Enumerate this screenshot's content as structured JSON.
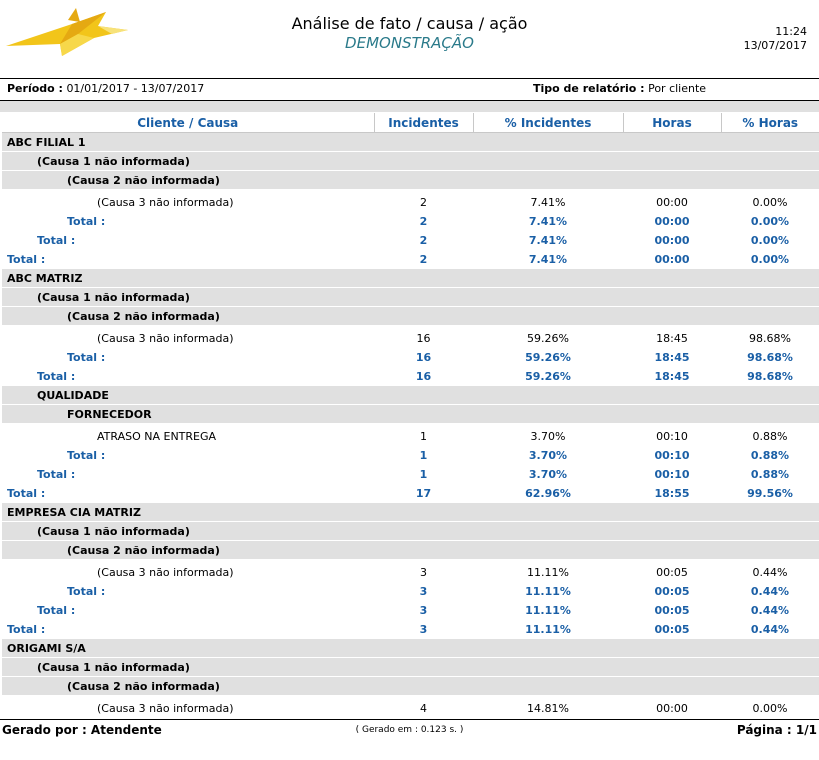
{
  "header": {
    "title": "Análise de fato / causa / ação",
    "subtitle": "DEMONSTRAÇÃO",
    "time": "11:24",
    "date": "13/07/2017"
  },
  "params": {
    "period_label": "Período :",
    "period_value": "01/01/2017 - 13/07/2017",
    "type_label": "Tipo de relatório :",
    "type_value": "Por cliente"
  },
  "columns": [
    "Cliente / Causa",
    "Incidentes",
    "% Incidentes",
    "Horas",
    "% Horas"
  ],
  "rows": [
    {
      "type": "grp",
      "level": 0,
      "label": "ABC FILIAL 1"
    },
    {
      "type": "grp",
      "level": 1,
      "label": "(Causa 1 não informada)"
    },
    {
      "type": "grp",
      "level": 2,
      "label": "(Causa 2 não informada)"
    },
    {
      "type": "det",
      "label": "(Causa 3 não informada)",
      "inc": "2",
      "pinc": "7.41%",
      "hrs": "00:00",
      "phrs": "0.00%"
    },
    {
      "type": "tot",
      "level": 2,
      "label": "Total :",
      "inc": "2",
      "pinc": "7.41%",
      "hrs": "00:00",
      "phrs": "0.00%"
    },
    {
      "type": "tot",
      "level": 1,
      "label": "Total :",
      "inc": "2",
      "pinc": "7.41%",
      "hrs": "00:00",
      "phrs": "0.00%"
    },
    {
      "type": "tot",
      "level": 0,
      "label": "Total :",
      "inc": "2",
      "pinc": "7.41%",
      "hrs": "00:00",
      "phrs": "0.00%"
    },
    {
      "type": "grp",
      "level": 0,
      "label": "ABC MATRIZ"
    },
    {
      "type": "grp",
      "level": 1,
      "label": "(Causa 1 não informada)"
    },
    {
      "type": "grp",
      "level": 2,
      "label": "(Causa 2 não informada)"
    },
    {
      "type": "det",
      "label": "(Causa 3 não informada)",
      "inc": "16",
      "pinc": "59.26%",
      "hrs": "18:45",
      "phrs": "98.68%"
    },
    {
      "type": "tot",
      "level": 2,
      "label": "Total :",
      "inc": "16",
      "pinc": "59.26%",
      "hrs": "18:45",
      "phrs": "98.68%"
    },
    {
      "type": "tot",
      "level": 1,
      "label": "Total :",
      "inc": "16",
      "pinc": "59.26%",
      "hrs": "18:45",
      "phrs": "98.68%"
    },
    {
      "type": "grp",
      "level": 1,
      "label": "QUALIDADE"
    },
    {
      "type": "grp",
      "level": 2,
      "label": "FORNECEDOR"
    },
    {
      "type": "det",
      "label": "ATRASO NA ENTREGA",
      "inc": "1",
      "pinc": "3.70%",
      "hrs": "00:10",
      "phrs": "0.88%"
    },
    {
      "type": "tot",
      "level": 2,
      "label": "Total :",
      "inc": "1",
      "pinc": "3.70%",
      "hrs": "00:10",
      "phrs": "0.88%"
    },
    {
      "type": "tot",
      "level": 1,
      "label": "Total :",
      "inc": "1",
      "pinc": "3.70%",
      "hrs": "00:10",
      "phrs": "0.88%"
    },
    {
      "type": "tot",
      "level": 0,
      "label": "Total :",
      "inc": "17",
      "pinc": "62.96%",
      "hrs": "18:55",
      "phrs": "99.56%"
    },
    {
      "type": "grp",
      "level": 0,
      "label": "EMPRESA CIA MATRIZ"
    },
    {
      "type": "grp",
      "level": 1,
      "label": "(Causa 1 não informada)"
    },
    {
      "type": "grp",
      "level": 2,
      "label": "(Causa 2 não informada)"
    },
    {
      "type": "det",
      "label": "(Causa 3 não informada)",
      "inc": "3",
      "pinc": "11.11%",
      "hrs": "00:05",
      "phrs": "0.44%"
    },
    {
      "type": "tot",
      "level": 2,
      "label": "Total :",
      "inc": "3",
      "pinc": "11.11%",
      "hrs": "00:05",
      "phrs": "0.44%"
    },
    {
      "type": "tot",
      "level": 1,
      "label": "Total :",
      "inc": "3",
      "pinc": "11.11%",
      "hrs": "00:05",
      "phrs": "0.44%"
    },
    {
      "type": "tot",
      "level": 0,
      "label": "Total :",
      "inc": "3",
      "pinc": "11.11%",
      "hrs": "00:05",
      "phrs": "0.44%"
    },
    {
      "type": "grp",
      "level": 0,
      "label": "ORIGAMI S/A"
    },
    {
      "type": "grp",
      "level": 1,
      "label": "(Causa 1 não informada)"
    },
    {
      "type": "grp",
      "level": 2,
      "label": "(Causa 2 não informada)"
    },
    {
      "type": "det",
      "label": "(Causa 3 não informada)",
      "inc": "4",
      "pinc": "14.81%",
      "hrs": "00:00",
      "phrs": "0.00%"
    }
  ],
  "footer": {
    "generated_by": "Gerado por : Atendente",
    "generated_in": "( Gerado em : 0.123 s. )",
    "page": "Página : 1/1"
  },
  "colors": {
    "accent_blue": "#1a5fa6",
    "band_grey": "#e0e0e0",
    "subtitle_teal": "#2a7a8a",
    "logo_yellow": "#f2c51a"
  }
}
